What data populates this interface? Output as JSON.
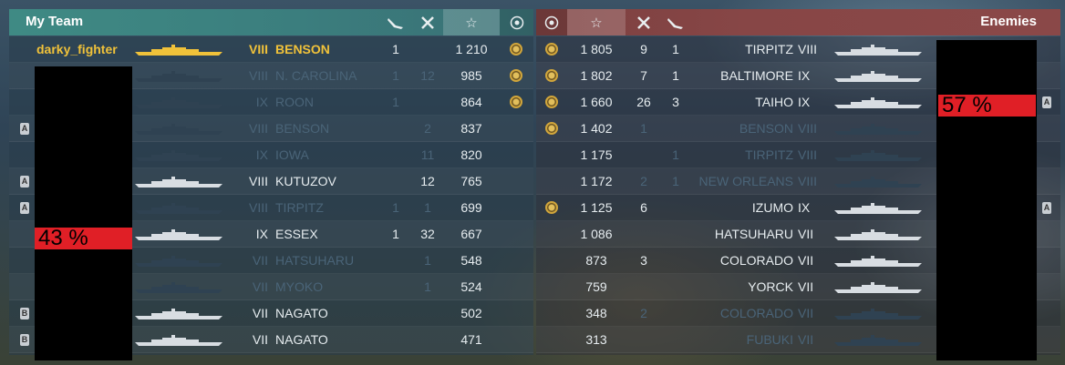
{
  "left_team": {
    "title": "My Team",
    "players": [
      {
        "name": "darky_fighter",
        "name_color": "gold",
        "tier": "VIII",
        "ship": "BENSON",
        "highlight": true,
        "planes": "1",
        "kills": "",
        "score": "1 210",
        "medal": true,
        "alive": true,
        "ship_color": "#f0c23a"
      },
      {
        "tier": "VIII",
        "ship": "N. CAROLINA",
        "planes": "1",
        "kills": "12",
        "score": "985",
        "medal": true,
        "alive": false
      },
      {
        "tier": "IX",
        "ship": "ROON",
        "planes": "1",
        "kills": "",
        "score": "864",
        "medal": true,
        "alive": false
      },
      {
        "tier": "VIII",
        "ship": "BENSON",
        "planes": "",
        "kills": "2",
        "score": "837",
        "medal": false,
        "alive": false,
        "badge": "A"
      },
      {
        "tier": "IX",
        "ship": "IOWA",
        "planes": "",
        "kills": "11",
        "score": "820",
        "medal": false,
        "alive": false
      },
      {
        "tier": "VIII",
        "ship": "KUTUZOV",
        "planes": "",
        "kills": "12",
        "score": "765",
        "medal": false,
        "alive": true,
        "badge": "A"
      },
      {
        "tier": "VIII",
        "ship": "TIRPITZ",
        "planes": "1",
        "kills": "1",
        "score": "699",
        "medal": false,
        "alive": false,
        "badge": "A"
      },
      {
        "tier": "IX",
        "ship": "ESSEX",
        "planes": "1",
        "kills": "32",
        "score": "667",
        "medal": false,
        "alive": true
      },
      {
        "tier": "VII",
        "ship": "HATSUHARU",
        "planes": "",
        "kills": "1",
        "score": "548",
        "medal": false,
        "alive": false
      },
      {
        "tier": "VII",
        "ship": "MYOKO",
        "planes": "",
        "kills": "1",
        "score": "524",
        "medal": false,
        "alive": false
      },
      {
        "tier": "VII",
        "ship": "NAGATO",
        "planes": "",
        "kills": "",
        "score": "502",
        "medal": false,
        "alive": true,
        "badge": "B"
      },
      {
        "tier": "VII",
        "ship": "NAGATO",
        "planes": "",
        "kills": "",
        "score": "471",
        "medal": false,
        "alive": true,
        "badge": "B"
      }
    ],
    "percent": "43 %"
  },
  "right_team": {
    "title": "Enemies",
    "players": [
      {
        "medal": true,
        "score": "1 805",
        "kills": "9",
        "planes": "1",
        "ship": "TIRPITZ",
        "tier": "VIII",
        "alive": true
      },
      {
        "medal": true,
        "score": "1 802",
        "kills": "7",
        "planes": "1",
        "ship": "BALTIMORE",
        "tier": "IX",
        "alive": true
      },
      {
        "medal": true,
        "score": "1 660",
        "kills": "26",
        "planes": "3",
        "ship": "TAIHO",
        "tier": "IX",
        "alive": true,
        "badge": "A"
      },
      {
        "medal": true,
        "score": "1 402",
        "kills": "1",
        "planes": "",
        "ship": "BENSON",
        "tier": "VIII",
        "alive": false
      },
      {
        "medal": false,
        "score": "1 175",
        "kills": "",
        "planes": "1",
        "ship": "TIRPITZ",
        "tier": "VIII",
        "alive": false
      },
      {
        "medal": false,
        "score": "1 172",
        "kills": "2",
        "planes": "1",
        "ship": "NEW ORLEANS",
        "tier": "VIII",
        "alive": false
      },
      {
        "medal": true,
        "score": "1 125",
        "kills": "6",
        "planes": "",
        "ship": "IZUMO",
        "tier": "IX",
        "alive": true,
        "badge": "A"
      },
      {
        "medal": false,
        "score": "1 086",
        "kills": "",
        "planes": "",
        "ship": "HATSUHARU",
        "tier": "VII",
        "alive": true
      },
      {
        "medal": false,
        "score": "873",
        "kills": "3",
        "planes": "",
        "ship": "COLORADO",
        "tier": "VII",
        "alive": true
      },
      {
        "medal": false,
        "score": "759",
        "kills": "",
        "planes": "",
        "ship": "YORCK",
        "tier": "VII",
        "alive": true
      },
      {
        "medal": false,
        "score": "348",
        "kills": "2",
        "planes": "",
        "ship": "COLORADO",
        "tier": "VII",
        "alive": false
      },
      {
        "medal": false,
        "score": "313",
        "kills": "",
        "planes": "",
        "ship": "FUBUKI",
        "tier": "VII",
        "alive": false
      }
    ],
    "percent": "57 %"
  },
  "header_icons": {
    "planes_icon": "plane-icon",
    "kills_icon": "crossed-swords-icon",
    "score_icon": "star-icon",
    "medal_icon": "medal-icon"
  },
  "colors": {
    "my_team_header": "#3f8a84",
    "enemy_header": "#874646",
    "player_gold": "#f0c23a",
    "percent_bar": "#e01f26",
    "dead_text": "#4a6478"
  }
}
